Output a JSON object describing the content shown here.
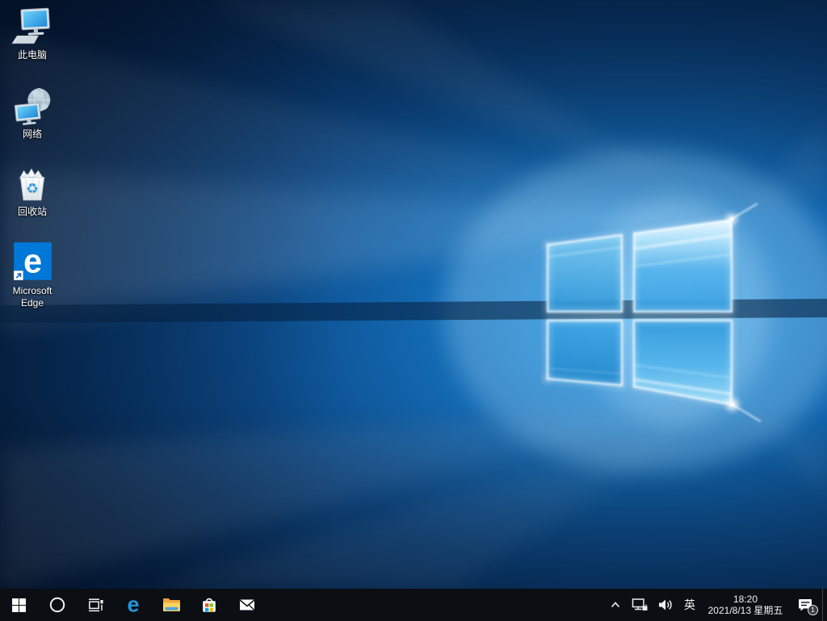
{
  "desktop": {
    "icons": [
      {
        "name": "this-pc",
        "label": "此电脑"
      },
      {
        "name": "network",
        "label": "网络"
      },
      {
        "name": "recycle-bin",
        "label": "回收站"
      },
      {
        "name": "microsoft-edge",
        "label": "Microsoft Edge"
      }
    ]
  },
  "taskbar": {
    "buttons": [
      {
        "icon": "start-windows-icon"
      },
      {
        "icon": "cortana-search-icon"
      },
      {
        "icon": "task-view-icon"
      },
      {
        "icon": "edge-browser-icon"
      },
      {
        "icon": "file-explorer-folder-icon"
      },
      {
        "icon": "microsoft-store-icon"
      },
      {
        "icon": "mail-envelope-icon"
      }
    ],
    "tray": {
      "hidden_icons": "show-hidden-icons-chevron",
      "network_icon": "ethernet-network-icon",
      "volume_icon": "speaker-volume-icon",
      "ime_label": "英",
      "time": "18:20",
      "date": "2021/8/13 星期五",
      "notification_count": "1"
    }
  },
  "colors": {
    "taskbar_bg": "#0b0e13",
    "wallpaper_deep_navy": "#051d3c",
    "wallpaper_bright_blue": "#2f9fe6",
    "edge_blue": "#2196dc",
    "edge_tile_blue": "#0078d7",
    "store_red": "#f1511b",
    "store_green": "#80cc28",
    "store_blue": "#00adef",
    "store_yellow": "#fbbc09",
    "folder_yellow": "#ffd45e"
  }
}
